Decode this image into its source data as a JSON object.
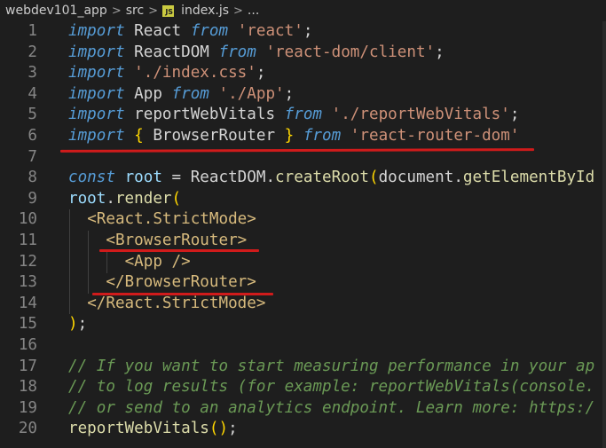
{
  "breadcrumb": {
    "folder": "webdev101_app",
    "subfolder": "src",
    "file_icon": "JS",
    "file": "index.js",
    "more": "...",
    "separator": ">"
  },
  "colors": {
    "background": "#1e1e1e",
    "keyword": "#569cd6",
    "string": "#ce9178",
    "function": "#dcdcaa",
    "variable": "#9cdcfe",
    "comment": "#6a9955",
    "annotation_underline": "#d01b1b"
  },
  "editor": {
    "lines": [
      {
        "n": "1",
        "tokens": [
          [
            "kw",
            "import"
          ],
          [
            "id",
            " React "
          ],
          [
            "kw",
            "from"
          ],
          [
            "id",
            " "
          ],
          [
            "str",
            "'react'"
          ],
          [
            "pun",
            ";"
          ]
        ]
      },
      {
        "n": "2",
        "tokens": [
          [
            "kw",
            "import"
          ],
          [
            "id",
            " ReactDOM "
          ],
          [
            "kw",
            "from"
          ],
          [
            "id",
            " "
          ],
          [
            "str",
            "'react-dom/client'"
          ],
          [
            "pun",
            ";"
          ]
        ]
      },
      {
        "n": "3",
        "tokens": [
          [
            "kw",
            "import"
          ],
          [
            "id",
            " "
          ],
          [
            "str",
            "'./index.css'"
          ],
          [
            "pun",
            ";"
          ]
        ]
      },
      {
        "n": "4",
        "tokens": [
          [
            "kw",
            "import"
          ],
          [
            "id",
            " App "
          ],
          [
            "kw",
            "from"
          ],
          [
            "id",
            " "
          ],
          [
            "str",
            "'./App'"
          ],
          [
            "pun",
            ";"
          ]
        ]
      },
      {
        "n": "5",
        "tokens": [
          [
            "kw",
            "import"
          ],
          [
            "id",
            " reportWebVitals "
          ],
          [
            "kw",
            "from"
          ],
          [
            "id",
            " "
          ],
          [
            "str",
            "'./reportWebVitals'"
          ],
          [
            "pun",
            ";"
          ]
        ]
      },
      {
        "n": "6",
        "tokens": [
          [
            "kw",
            "import"
          ],
          [
            "id",
            " "
          ],
          [
            "br1",
            "{"
          ],
          [
            "id",
            " BrowserRouter "
          ],
          [
            "br1",
            "}"
          ],
          [
            "id",
            " "
          ],
          [
            "kw",
            "from"
          ],
          [
            "id",
            " "
          ],
          [
            "str",
            "'react-router-dom'"
          ]
        ]
      },
      {
        "n": "7",
        "tokens": []
      },
      {
        "n": "8",
        "tokens": [
          [
            "kw",
            "const"
          ],
          [
            "id",
            " "
          ],
          [
            "var",
            "root"
          ],
          [
            "id",
            " = ReactDOM."
          ],
          [
            "fn",
            "createRoot"
          ],
          [
            "br1",
            "("
          ],
          [
            "id",
            "document."
          ],
          [
            "fn",
            "getElementById"
          ]
        ]
      },
      {
        "n": "9",
        "tokens": [
          [
            "var",
            "root"
          ],
          [
            "id",
            "."
          ],
          [
            "fn",
            "render"
          ],
          [
            "br1",
            "("
          ]
        ]
      },
      {
        "n": "10",
        "tokens": [
          [
            "id",
            "  "
          ],
          [
            "tag",
            "<React.StrictMode>"
          ]
        ]
      },
      {
        "n": "11",
        "tokens": [
          [
            "id",
            "    "
          ],
          [
            "tag",
            "<BrowserRouter>"
          ]
        ]
      },
      {
        "n": "12",
        "tokens": [
          [
            "id",
            "      "
          ],
          [
            "tag",
            "<App />"
          ]
        ]
      },
      {
        "n": "13",
        "tokens": [
          [
            "id",
            "    "
          ],
          [
            "tag",
            "</BrowserRouter>"
          ]
        ]
      },
      {
        "n": "14",
        "tokens": [
          [
            "id",
            "  "
          ],
          [
            "tag",
            "</React.StrictMode>"
          ]
        ]
      },
      {
        "n": "15",
        "tokens": [
          [
            "br1",
            ")"
          ],
          [
            "pun",
            ";"
          ]
        ]
      },
      {
        "n": "16",
        "tokens": []
      },
      {
        "n": "17",
        "tokens": [
          [
            "cm",
            "// If you want to start measuring performance in your ap"
          ]
        ]
      },
      {
        "n": "18",
        "tokens": [
          [
            "cm",
            "// to log results (for example: reportWebVitals(console."
          ]
        ]
      },
      {
        "n": "19",
        "tokens": [
          [
            "cm",
            "// or send to an analytics endpoint. Learn more: https:/"
          ]
        ]
      },
      {
        "n": "20",
        "tokens": [
          [
            "fn",
            "reportWebVitals"
          ],
          [
            "br1",
            "("
          ],
          [
            "br1",
            ")"
          ],
          [
            "pun",
            ";"
          ]
        ]
      }
    ]
  }
}
